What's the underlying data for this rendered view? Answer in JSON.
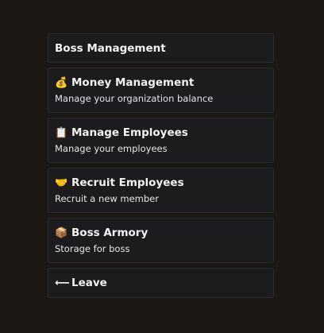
{
  "menu": {
    "header": "Boss Management",
    "items": [
      {
        "icon": "💰",
        "icon_name": "money-bag-icon",
        "title": "Money Management",
        "description": "Manage your organization balance"
      },
      {
        "icon": "📋",
        "icon_name": "clipboard-icon",
        "title": "Manage Employees",
        "description": "Manage your employees"
      },
      {
        "icon": "🤝",
        "icon_name": "handshake-icon",
        "title": "Recruit Employees",
        "description": "Recruit a new member"
      },
      {
        "icon": "📦",
        "icon_name": "box-icon",
        "title": "Boss Armory",
        "description": "Storage for boss"
      }
    ],
    "leave": {
      "icon": "⟵",
      "icon_name": "arrow-left-icon",
      "title": "Leave"
    }
  }
}
